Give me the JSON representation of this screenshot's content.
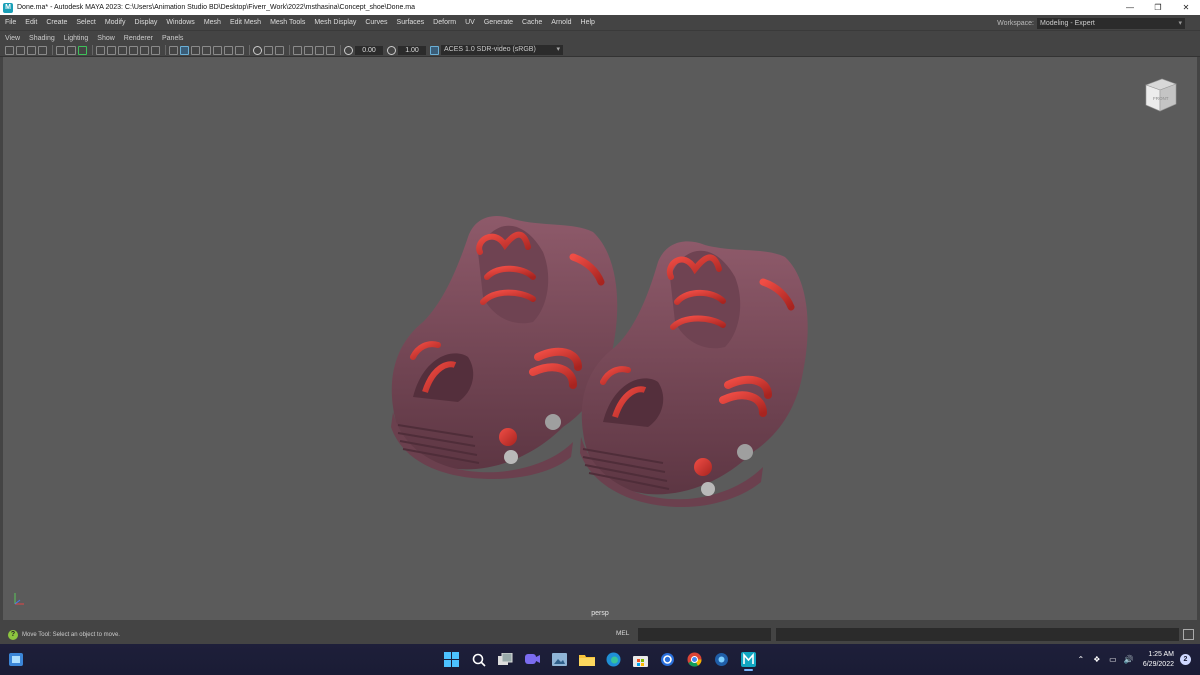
{
  "window": {
    "title": "Done.ma* - Autodesk MAYA 2023: C:\\Users\\Animation Studio BD\\Desktop\\Fiverr_Work\\2022\\msthasina\\Concept_shoe\\Done.ma",
    "app_icon_letter": "M"
  },
  "menu": {
    "items": [
      "File",
      "Edit",
      "Create",
      "Select",
      "Modify",
      "Display",
      "Windows",
      "Mesh",
      "Edit Mesh",
      "Mesh Tools",
      "Mesh Display",
      "Curves",
      "Surfaces",
      "Deform",
      "UV",
      "Generate",
      "Cache",
      "Arnold",
      "Help"
    ],
    "workspace_label": "Workspace:",
    "workspace_value": "Modeling - Expert"
  },
  "panel_menu": {
    "items": [
      "View",
      "Shading",
      "Lighting",
      "Show",
      "Renderer",
      "Panels"
    ]
  },
  "panel_toolbar": {
    "exposure": "0.00",
    "gamma": "1.00",
    "color_transform": "ACES 1.0 SDR-video (sRGB)"
  },
  "viewport": {
    "camera": "persp",
    "viewcube_face": "FRONT",
    "colors": {
      "background": "#5b5b5b",
      "shoe_body": "#7e4d5c",
      "shoe_accent": "#d23a33"
    }
  },
  "status": {
    "help_line": "Move Tool: Select an object to move.",
    "command_language": "MEL"
  },
  "taskbar": {
    "time": "1:25 AM",
    "date": "6/29/2022",
    "notification_count": "2",
    "apps": [
      "start-icon",
      "search-icon",
      "task-view-icon",
      "chat-icon",
      "media-icon",
      "file-explorer-icon",
      "edge-icon",
      "store-icon",
      "settings-icon",
      "chrome-icon",
      "photos-icon",
      "maya-icon"
    ]
  }
}
